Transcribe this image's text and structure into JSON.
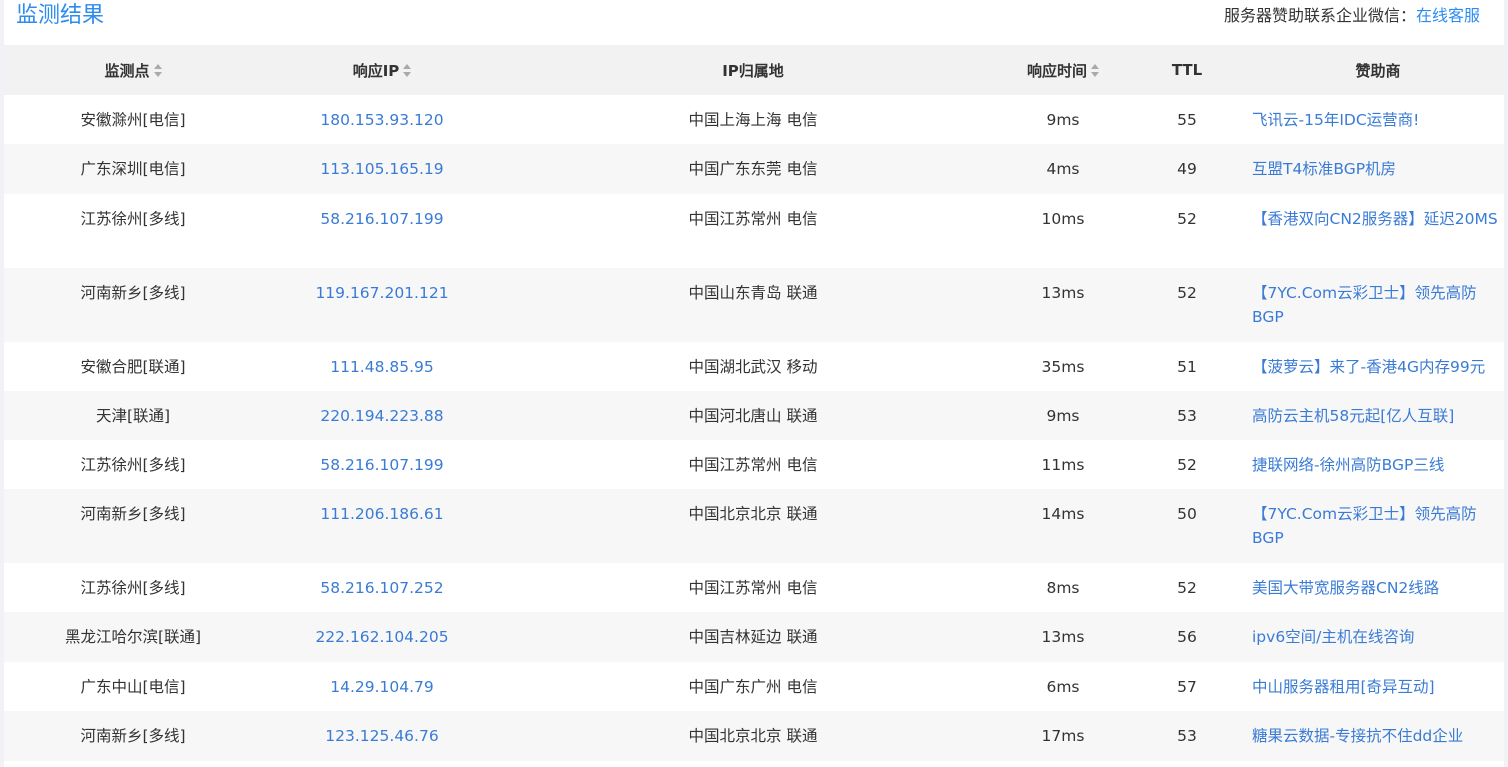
{
  "header": {
    "title": "监测结果",
    "contact_label": "服务器赞助联系企业微信：",
    "contact_link": "在线客服"
  },
  "columns": [
    "监测点",
    "响应IP",
    "IP归属地",
    "响应时间",
    "TTL",
    "赞助商"
  ],
  "rows": [
    {
      "point": "安徽滁州[电信]",
      "ip": "180.153.93.120",
      "location": "中国上海上海 电信",
      "time": "9ms",
      "ttl": "55",
      "sponsor": "飞讯云-15年IDC运营商!"
    },
    {
      "point": "广东深圳[电信]",
      "ip": "113.105.165.19",
      "location": "中国广东东莞 电信",
      "time": "4ms",
      "ttl": "49",
      "sponsor": "互盟T4标准BGP机房"
    },
    {
      "point": "江苏徐州[多线]",
      "ip": "58.216.107.199",
      "location": "中国江苏常州 电信",
      "time": "10ms",
      "ttl": "52",
      "sponsor": "【香港双向CN2服务器】延迟20MS"
    },
    {
      "point": "河南新乡[多线]",
      "ip": "119.167.201.121",
      "location": "中国山东青岛 联通",
      "time": "13ms",
      "ttl": "52",
      "sponsor": "【7YC.Com云彩卫士】领先高防BGP"
    },
    {
      "point": "安徽合肥[联通]",
      "ip": "111.48.85.95",
      "location": "中国湖北武汉 移动",
      "time": "35ms",
      "ttl": "51",
      "sponsor": "【菠萝云】来了-香港4G内存99元"
    },
    {
      "point": "天津[联通]",
      "ip": "220.194.223.88",
      "location": "中国河北唐山 联通",
      "time": "9ms",
      "ttl": "53",
      "sponsor": "高防云主机58元起[亿人互联]"
    },
    {
      "point": "江苏徐州[多线]",
      "ip": "58.216.107.199",
      "location": "中国江苏常州 电信",
      "time": "11ms",
      "ttl": "52",
      "sponsor": "捷联网络-徐州高防BGP三线"
    },
    {
      "point": "河南新乡[多线]",
      "ip": "111.206.186.61",
      "location": "中国北京北京 联通",
      "time": "14ms",
      "ttl": "50",
      "sponsor": "【7YC.Com云彩卫士】领先高防BGP"
    },
    {
      "point": "江苏徐州[多线]",
      "ip": "58.216.107.252",
      "location": "中国江苏常州 电信",
      "time": "8ms",
      "ttl": "52",
      "sponsor": "美国大带宽服务器CN2线路"
    },
    {
      "point": "黑龙江哈尔滨[联通]",
      "ip": "222.162.104.205",
      "location": "中国吉林延边 联通",
      "time": "13ms",
      "ttl": "56",
      "sponsor": "ipv6空间/主机在线咨询"
    },
    {
      "point": "广东中山[电信]",
      "ip": "14.29.104.79",
      "location": "中国广东广州 电信",
      "time": "6ms",
      "ttl": "57",
      "sponsor": "中山服务器租用[奇异互动]"
    },
    {
      "point": "河南新乡[多线]",
      "ip": "123.125.46.76",
      "location": "中国北京北京 联通",
      "time": "17ms",
      "ttl": "53",
      "sponsor": "糖果云数据-专接抗不住dd企业"
    }
  ]
}
